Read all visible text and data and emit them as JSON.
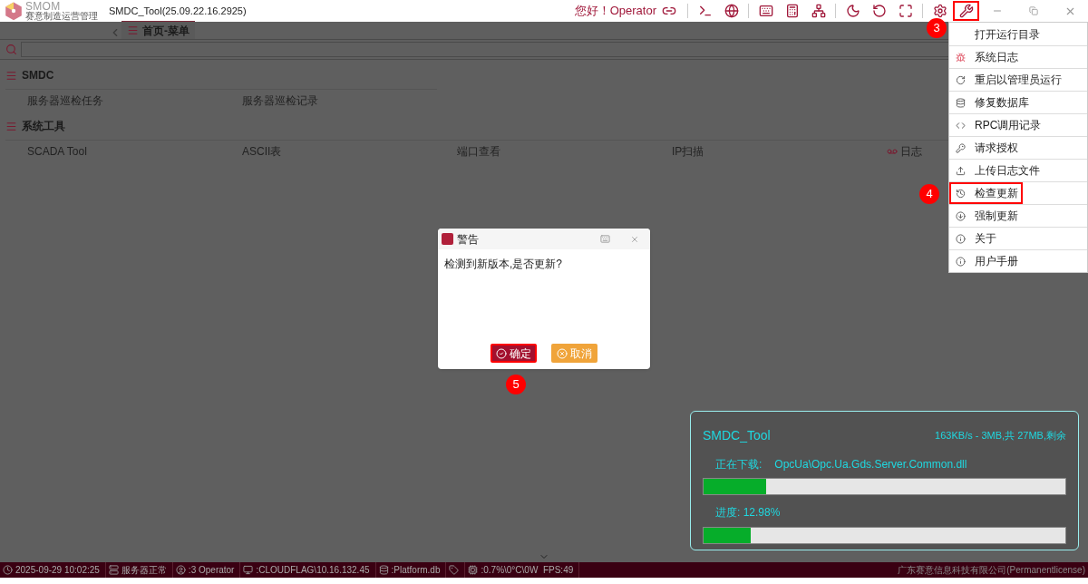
{
  "app": {
    "logo": "SMOM",
    "logo_subtitle": "赛意制造运营管理",
    "title": "SMDC_Tool(25.09.22.16.2925)",
    "greeting": "您好！Operator"
  },
  "toolbar": [
    {
      "kind": "terminal",
      "highlighted": false
    },
    {
      "kind": "globe",
      "highlighted": false
    },
    {
      "kind": "keyboard",
      "highlighted": false
    },
    {
      "kind": "calculator",
      "highlighted": false
    },
    {
      "kind": "network",
      "highlighted": false
    },
    {
      "kind": "moon",
      "highlighted": false
    },
    {
      "kind": "refresh",
      "highlighted": false
    },
    {
      "kind": "fullscreen",
      "highlighted": false
    },
    {
      "kind": "settings",
      "highlighted": false
    },
    {
      "kind": "tools",
      "highlighted": true
    }
  ],
  "tab": {
    "label": "首页-菜单"
  },
  "sections": [
    {
      "title": "SMDC",
      "items": [
        {
          "label": "服务器巡检任务",
          "kind": "plain"
        },
        {
          "label": "服务器巡检记录",
          "kind": "plain"
        }
      ]
    },
    {
      "title": "系统工具",
      "items": [
        {
          "label": "SCADA Tool",
          "kind": "plain"
        },
        {
          "label": "ASCII表",
          "kind": "plain"
        },
        {
          "label": "端口查看",
          "kind": "plain"
        },
        {
          "label": "IP扫描",
          "kind": "plain"
        },
        {
          "label": "日志",
          "kind": "log"
        }
      ]
    }
  ],
  "menu": [
    {
      "label": "打开运行目录",
      "kind": "none",
      "highlighted": false
    },
    {
      "label": "系统日志",
      "kind": "bug",
      "highlighted": false
    },
    {
      "label": "重启以管理员运行",
      "kind": "restart",
      "highlighted": false
    },
    {
      "label": "修复数据库",
      "kind": "database",
      "highlighted": false
    },
    {
      "label": "RPC调用记录",
      "kind": "rpc",
      "highlighted": false
    },
    {
      "label": "请求授权",
      "kind": "key",
      "highlighted": false
    },
    {
      "label": "上传日志文件",
      "kind": "upload",
      "highlighted": false
    },
    {
      "label": "检查更新",
      "kind": "update",
      "highlighted": true
    },
    {
      "label": "强制更新",
      "kind": "download",
      "highlighted": false
    },
    {
      "label": "关于",
      "kind": "info",
      "highlighted": false
    },
    {
      "label": "用户手册",
      "kind": "info",
      "highlighted": false
    }
  ],
  "dialog": {
    "title": "警告",
    "message": "检测到新版本,是否更新?",
    "buttons": [
      {
        "label": "确定",
        "kind": "ok",
        "highlighted": true
      },
      {
        "label": "取消",
        "kind": "cancel",
        "highlighted": false
      }
    ]
  },
  "steps": [
    "3",
    "4",
    "5"
  ],
  "download": {
    "title": "SMDC_Tool",
    "speed": "163KB/s - 3MB,共 27MB,剩余",
    "file_label": "正在下载:",
    "file": "OpcUa\\Opc.Ua.Gds.Server.Common.dll",
    "file_bar": {
      "level": 0.174
    },
    "progress_label": "进度: 12.98%",
    "progress_bar": {
      "level": 0.13
    }
  },
  "status_bar": [
    {
      "kind": "clock",
      "text": "2025-09-29 10:02:25"
    },
    {
      "kind": "server",
      "text": "服务器正常"
    },
    {
      "kind": "user",
      "text": ":3 Operator"
    },
    {
      "kind": "monitor",
      "text": ":CLOUDFLAG\\10.16.132.45"
    },
    {
      "kind": "database",
      "text": ":Platform.db"
    },
    {
      "kind": "tag"
    },
    {
      "kind": "cpu",
      "text": ":0.7%\\0°C\\0W  FPS:49"
    }
  ],
  "company": "广东赛意信息科技有限公司(Permanentlicense)"
}
